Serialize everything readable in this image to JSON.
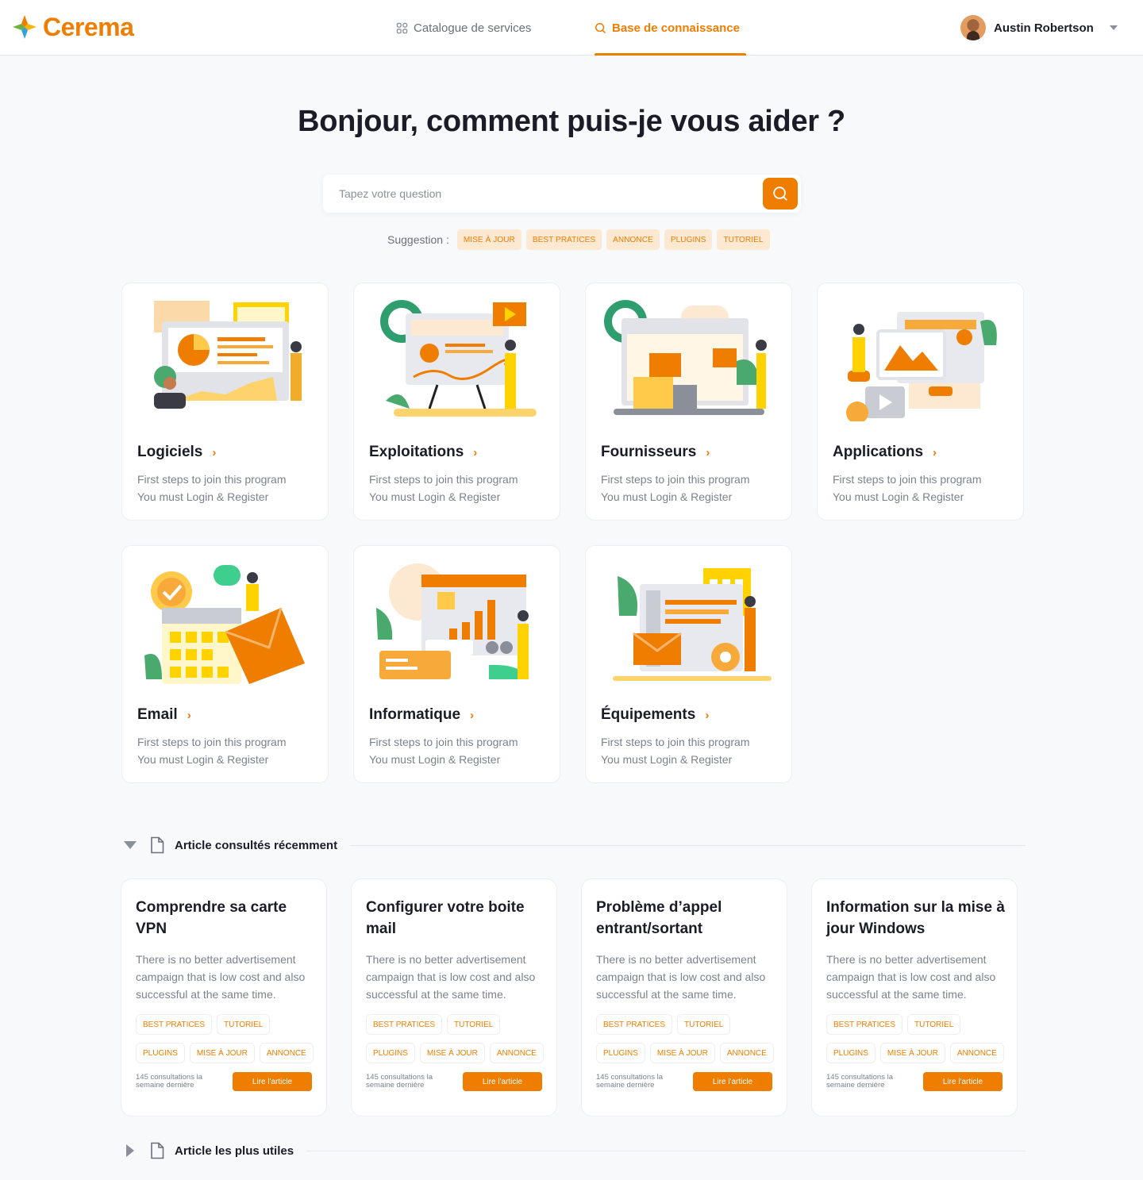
{
  "header": {
    "logo_text": "Cerema",
    "nav": {
      "catalog": "Catalogue de services",
      "knowledge_base": "Base de connaissance"
    },
    "user_name": "Austin Robertson"
  },
  "hero": {
    "title": "Bonjour, comment puis-je vous aider ?",
    "search_placeholder": "Tapez votre question",
    "suggestion_label": "Suggestion :",
    "suggestions": [
      "MISE À JOUR",
      "BEST PRATICES",
      "ANNONCE",
      "PLUGINS",
      "TUTORIEL"
    ]
  },
  "categories": [
    {
      "title": "Logiciels",
      "line1": "First steps to join this program",
      "line2": "You must Login & Register",
      "icon": "software-illustration"
    },
    {
      "title": "Exploitations",
      "line1": "First steps to join this program",
      "line2": "You must Login & Register",
      "icon": "presentation-illustration"
    },
    {
      "title": "Fournisseurs",
      "line1": "First steps to join this program",
      "line2": "You must Login & Register",
      "icon": "suppliers-illustration"
    },
    {
      "title": "Applications",
      "line1": "First steps to join this program",
      "line2": "You must Login & Register",
      "icon": "applications-illustration"
    },
    {
      "title": "Email",
      "line1": "First steps to join this program",
      "line2": "You must Login & Register",
      "icon": "email-illustration"
    },
    {
      "title": "Informatique",
      "line1": "First steps to join this program",
      "line2": "You must Login & Register",
      "icon": "it-illustration"
    },
    {
      "title": "Équipements",
      "line1": "First steps to join this program",
      "line2": "You must Login & Register",
      "icon": "equipment-illustration"
    }
  ],
  "recent_section": {
    "title": "Article consultés récemment",
    "expanded": true
  },
  "articles": [
    {
      "title": "Comprendre sa carte VPN",
      "description": "There is no better advertisement campaign that is low cost and also successful at the same time.",
      "tags": [
        "BEST PRATICES",
        "TUTORIEL",
        "PLUGINS",
        "MISE À JOUR",
        "ANNONCE"
      ],
      "views": "145 consultations la semaine dernière",
      "button": "Lire l'article"
    },
    {
      "title": "Configurer votre boite mail",
      "description": "There is no better advertisement campaign that is low cost and also successful at the same time.",
      "tags": [
        "BEST PRATICES",
        "TUTORIEL",
        "PLUGINS",
        "MISE À JOUR",
        "ANNONCE"
      ],
      "views": "145 consultations la semaine dernière",
      "button": "Lire l'article"
    },
    {
      "title": "Problème d’appel entrant/sortant",
      "description": "There is no better advertisement campaign that is low cost and also successful at the same time.",
      "tags": [
        "BEST PRATICES",
        "TUTORIEL",
        "PLUGINS",
        "MISE À JOUR",
        "ANNONCE"
      ],
      "views": "145 consultations la semaine dernière",
      "button": "Lire l'article"
    },
    {
      "title": "Information sur la mise à jour Windows",
      "description": "There is no better advertisement campaign that is low cost and also successful at the same time.",
      "tags": [
        "BEST PRATICES",
        "TUTORIEL",
        "PLUGINS",
        "MISE À JOUR",
        "ANNONCE"
      ],
      "views": "145 consultations la semaine dernière",
      "button": "Lire l'article"
    }
  ],
  "useful_section": {
    "title": "Article les plus utiles",
    "expanded": false
  },
  "colors": {
    "accent": "#ef7d00",
    "accent_light": "#fde8d2",
    "background": "#f8f9fb",
    "text": "#1c1c28",
    "muted": "#7c818c"
  }
}
